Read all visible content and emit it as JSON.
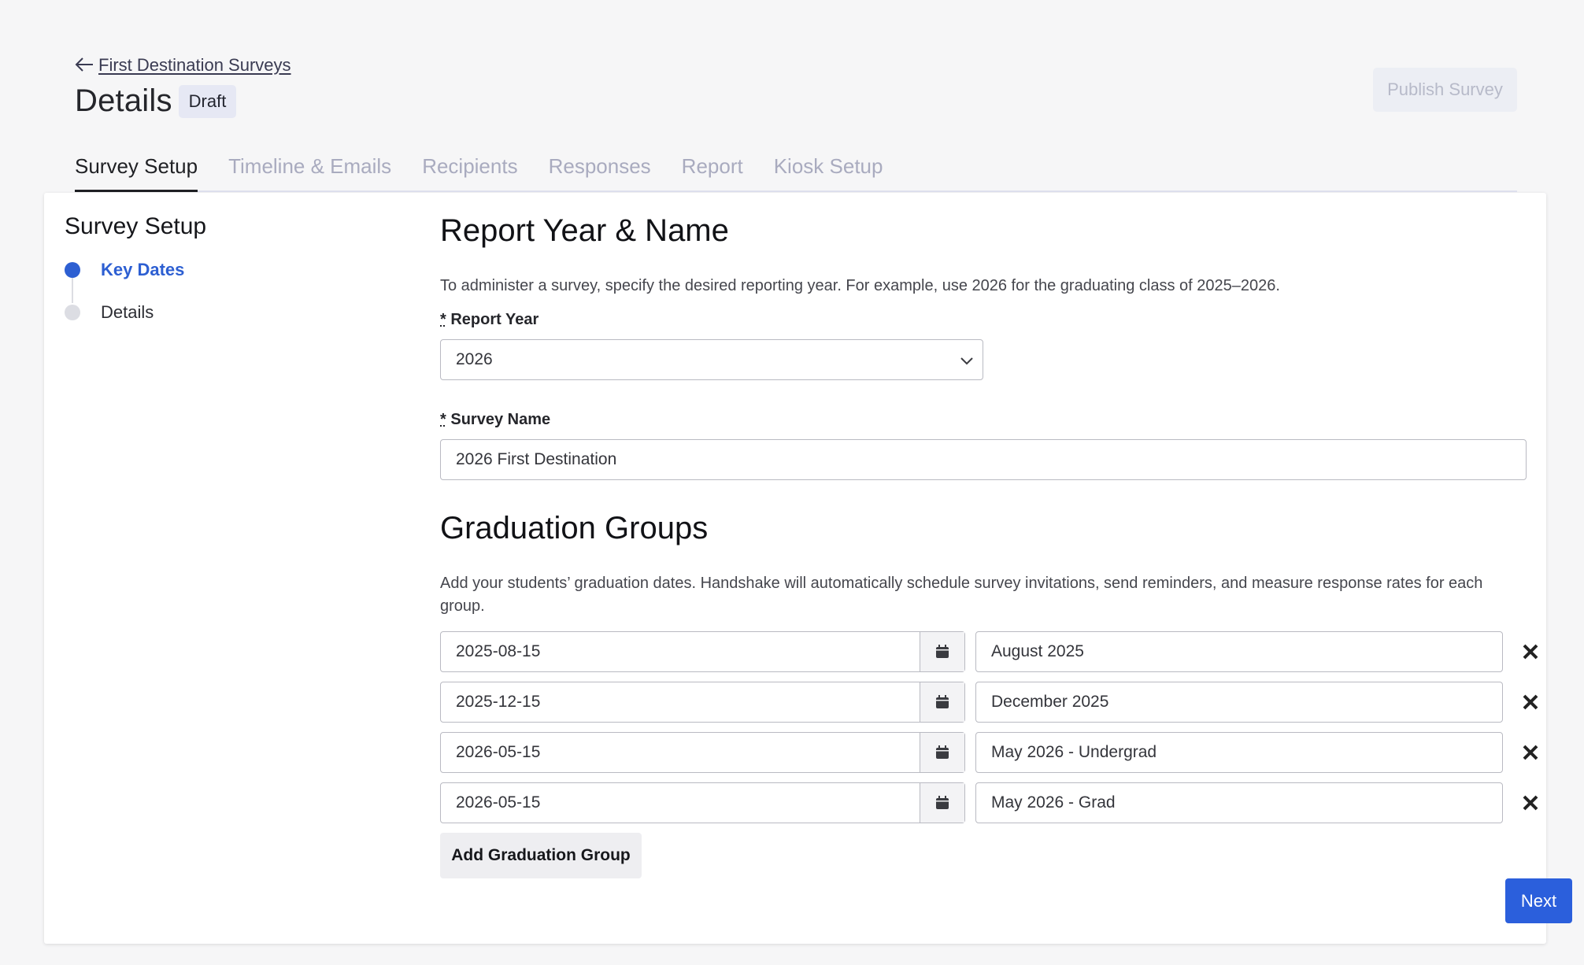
{
  "header": {
    "back_link": "First Destination Surveys",
    "title": "Details",
    "badge": "Draft",
    "publish_label": "Publish Survey"
  },
  "tabs": [
    {
      "label": "Survey Setup",
      "active": true
    },
    {
      "label": "Timeline & Emails",
      "active": false
    },
    {
      "label": "Recipients",
      "active": false
    },
    {
      "label": "Responses",
      "active": false
    },
    {
      "label": "Report",
      "active": false
    },
    {
      "label": "Kiosk Setup",
      "active": false
    }
  ],
  "sidebar": {
    "title": "Survey Setup",
    "steps": [
      {
        "label": "Key Dates"
      },
      {
        "label": "Details"
      }
    ]
  },
  "report_section": {
    "title": "Report Year & Name",
    "description": "To administer a survey, specify the desired reporting year. For example, use 2026 for the graduating class of 2025–2026.",
    "report_year_label": "Report Year",
    "report_year_value": "2026",
    "survey_name_label": "Survey Name",
    "survey_name_value": "2026 First Destination"
  },
  "graduation_section": {
    "title": "Graduation Groups",
    "description": "Add your students’ graduation dates. Handshake will automatically schedule survey invitations, send reminders, and measure response rates for each group.",
    "groups": [
      {
        "date": "2025-08-15",
        "name": "August 2025"
      },
      {
        "date": "2025-12-15",
        "name": "December 2025"
      },
      {
        "date": "2026-05-15",
        "name": "May 2026 - Undergrad"
      },
      {
        "date": "2026-05-15",
        "name": "May 2026 - Grad"
      }
    ],
    "add_label": "Add Graduation Group"
  },
  "footer": {
    "next_label": "Next"
  },
  "colors": {
    "accent": "#2b5fdc",
    "active_step": "#2d5fd2",
    "inactive_tab": "#a9abbf"
  }
}
